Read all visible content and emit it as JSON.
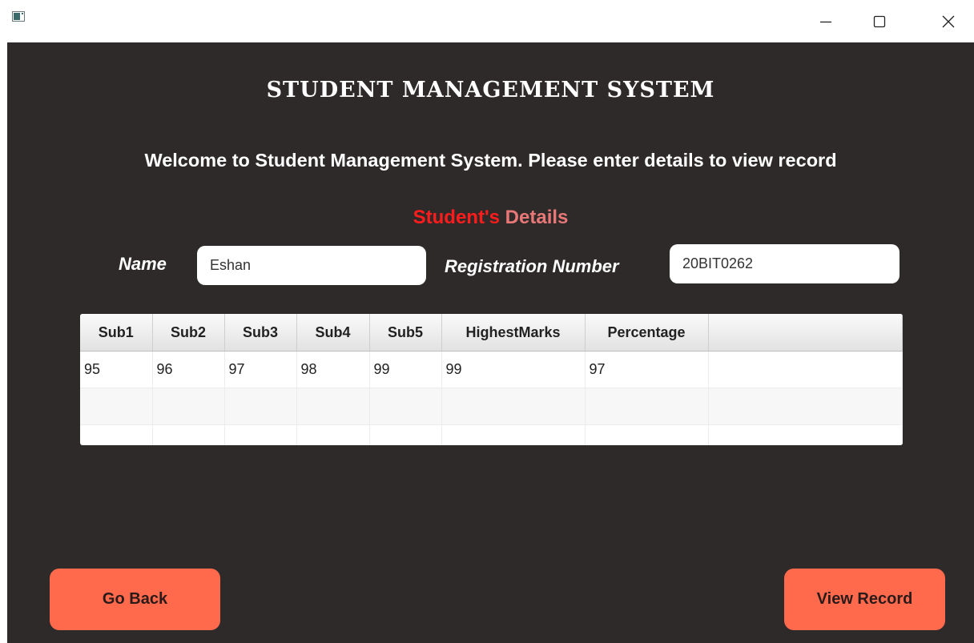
{
  "window": {
    "icons": {
      "app": "app-window-icon",
      "minimize": "minimize-icon",
      "maximize": "maximize-icon",
      "close": "close-icon"
    }
  },
  "header": {
    "title": "STUDENT MANAGEMENT SYSTEM",
    "welcome": "Welcome to Student Management System. Please enter details to view record"
  },
  "section": {
    "title_part1": "Student's",
    "title_part2": " Details"
  },
  "form": {
    "name_label": "Name",
    "name_value": "Eshan",
    "reg_label": "Registration Number",
    "reg_value": "20BIT0262"
  },
  "table": {
    "columns": [
      "Sub1",
      "Sub2",
      "Sub3",
      "Sub4",
      "Sub5",
      "HighestMarks",
      "Percentage"
    ],
    "rows": [
      [
        "95",
        "96",
        "97",
        "98",
        "99",
        "99",
        "97"
      ]
    ]
  },
  "buttons": {
    "back": "Go Back",
    "view": "View Record"
  },
  "colors": {
    "background": "#2f2a2a",
    "accent": "#ff6a4c",
    "section_red": "#ff1c1c",
    "section_pink": "#e87878"
  }
}
